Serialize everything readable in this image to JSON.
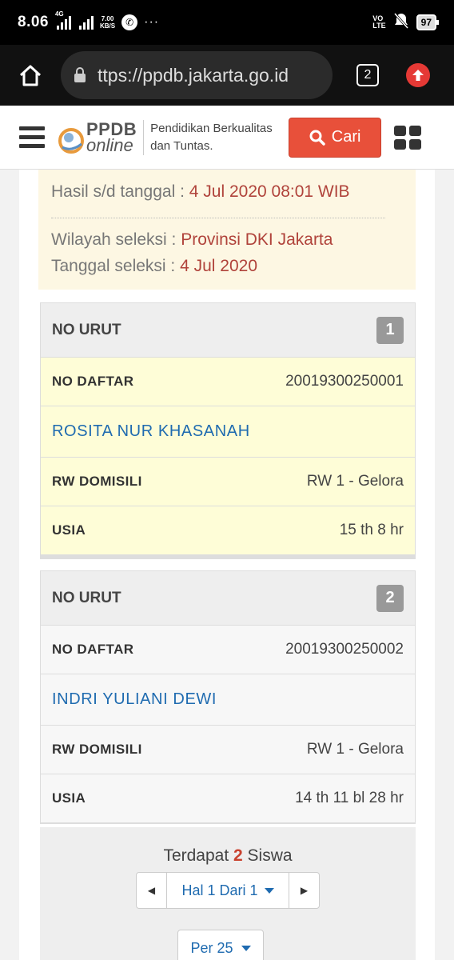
{
  "status_bar": {
    "time": "8.06",
    "network": "4G",
    "speed_value": "7.00",
    "speed_unit": "KB/S",
    "volte_top": "VO",
    "volte_bottom": "LTE",
    "battery": "97"
  },
  "browser": {
    "url": "ttps://ppdb.jakarta.go.id",
    "tab_count": "2"
  },
  "header": {
    "logo_ppdb": "PPDB",
    "logo_online": "online",
    "tagline_line1": "Pendidikan Berkualitas",
    "tagline_line2": "dan Tuntas.",
    "search_label": "Cari"
  },
  "info": {
    "result_label": "Hasil s/d tanggal : ",
    "result_value": "4 Jul 2020 08:01 WIB",
    "region_label": "Wilayah seleksi : ",
    "region_value": "Provinsi DKI Jakarta",
    "date_label": "Tanggal seleksi : ",
    "date_value": "4 Jul 2020"
  },
  "labels": {
    "no_urut": "NO URUT",
    "no_daftar": "NO DAFTAR",
    "rw_domisili": "RW DOMISILI",
    "usia": "USIA"
  },
  "students": [
    {
      "rank": "1",
      "reg_no": "20019300250001",
      "name": "ROSITA NUR KHASANAH",
      "rw": "RW 1 - Gelora",
      "age": "15 th 8 hr"
    },
    {
      "rank": "2",
      "reg_no": "20019300250002",
      "name": "INDRI YULIANI DEWI",
      "rw": "RW 1 - Gelora",
      "age": "14 th 11 bl 28 hr"
    }
  ],
  "footer": {
    "total_prefix": "Terdapat ",
    "total_count": "2",
    "total_suffix": " Siswa",
    "page_label": "Hal 1 Dari 1",
    "per_page_label": "Per 25"
  },
  "colors": {
    "accent_red": "#e8503a",
    "link_blue": "#1f6bb0",
    "highlight_yellow": "#fefdd7",
    "info_bg": "#fdf7e3"
  }
}
